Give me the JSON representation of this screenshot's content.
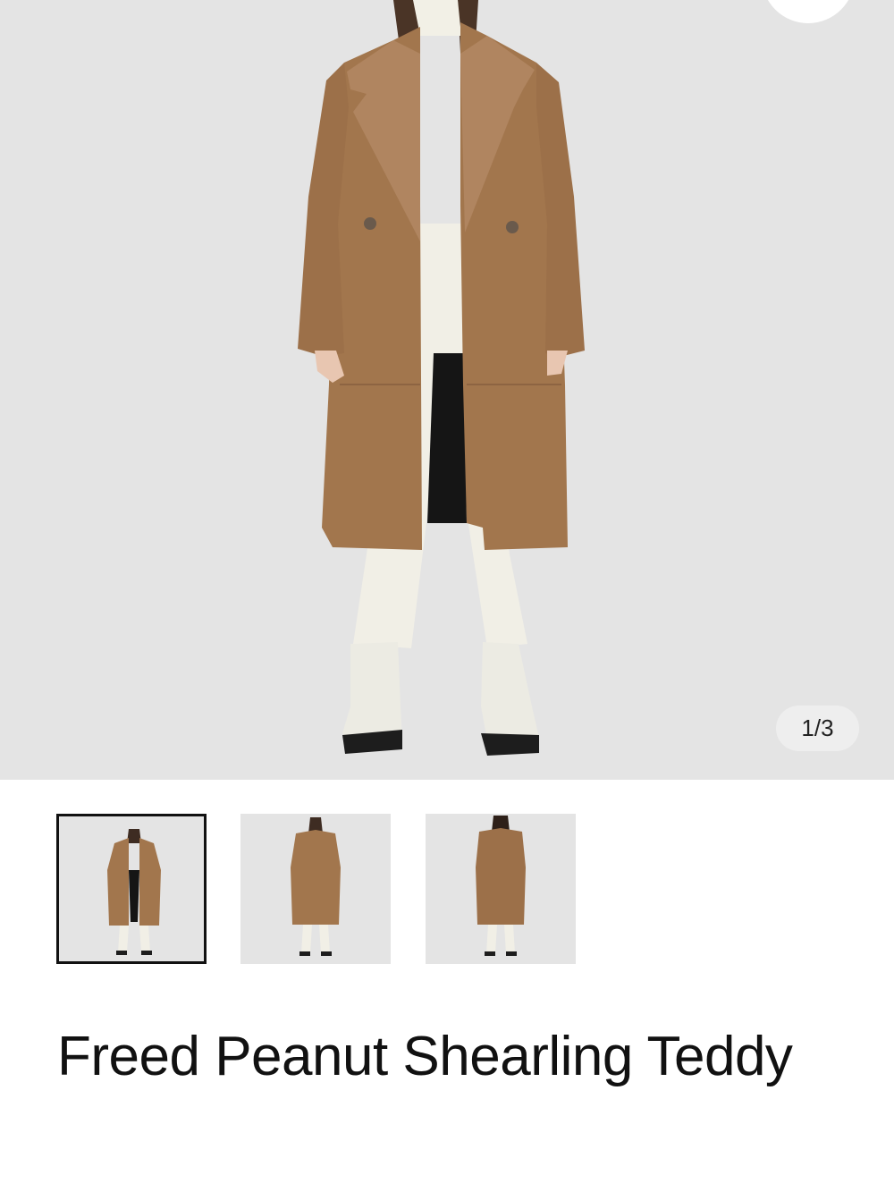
{
  "gallery": {
    "counter": "1/3",
    "thumbnails": [
      {
        "label": "front view open",
        "selected": true
      },
      {
        "label": "front view closed",
        "selected": false
      },
      {
        "label": "back view",
        "selected": false
      }
    ]
  },
  "product": {
    "title": "Freed Peanut Shearling Teddy"
  },
  "colors": {
    "hero_background": "#e4e4e4",
    "coat": "#a2764d",
    "cream": "#f1efe6"
  }
}
